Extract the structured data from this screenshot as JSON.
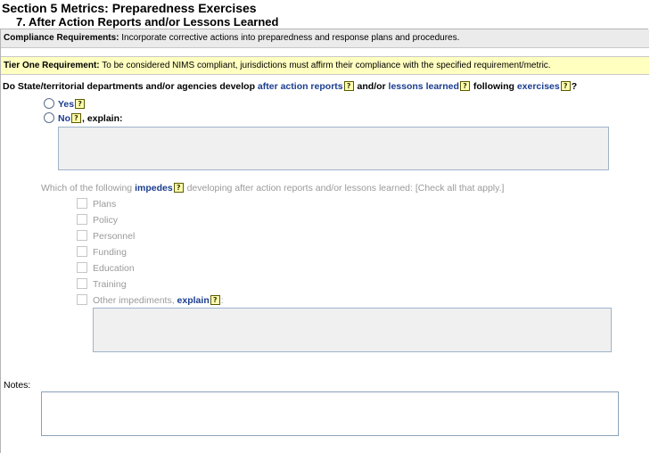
{
  "header": {
    "section_title": "Section 5 Metrics:  Preparedness Exercises",
    "subsection_title": "7. After Action Reports and/or Lessons Learned"
  },
  "compliance": {
    "label": "Compliance Requirements:",
    "text": " Incorporate corrective actions into preparedness and response plans and procedures."
  },
  "tier": {
    "label": "Tier One Requirement:",
    "text": " To be considered NIMS compliant, jurisdictions must affirm their compliance with the specified requirement/metric."
  },
  "question": {
    "part1": "Do State/territorial departments and/or agencies develop ",
    "link1": "after action reports",
    "part2": " and/or ",
    "link2": "lessons learned",
    "part3": " following ",
    "link3": "exercises",
    "part4": "?"
  },
  "help_glyph": "?",
  "options": {
    "yes": "Yes",
    "no": "No",
    "no_suffix": ", explain:"
  },
  "impedes": {
    "part1": "Which of the following ",
    "link": "impedes",
    "part2": " developing after action reports and/or lessons learned: [Check all that apply.]",
    "items": [
      "Plans",
      "Policy",
      "Personnel",
      "Funding",
      "Education",
      "Training"
    ],
    "other_prefix": "Other impediments, ",
    "other_link": "explain",
    "other_suffix": ":"
  },
  "notes": {
    "label": "Notes:"
  },
  "colors": {
    "link": "#1a3d8f",
    "tier_band": "#ffffc0",
    "compliance_band": "#ebebeb",
    "disabled_text": "#9a9a9a"
  }
}
